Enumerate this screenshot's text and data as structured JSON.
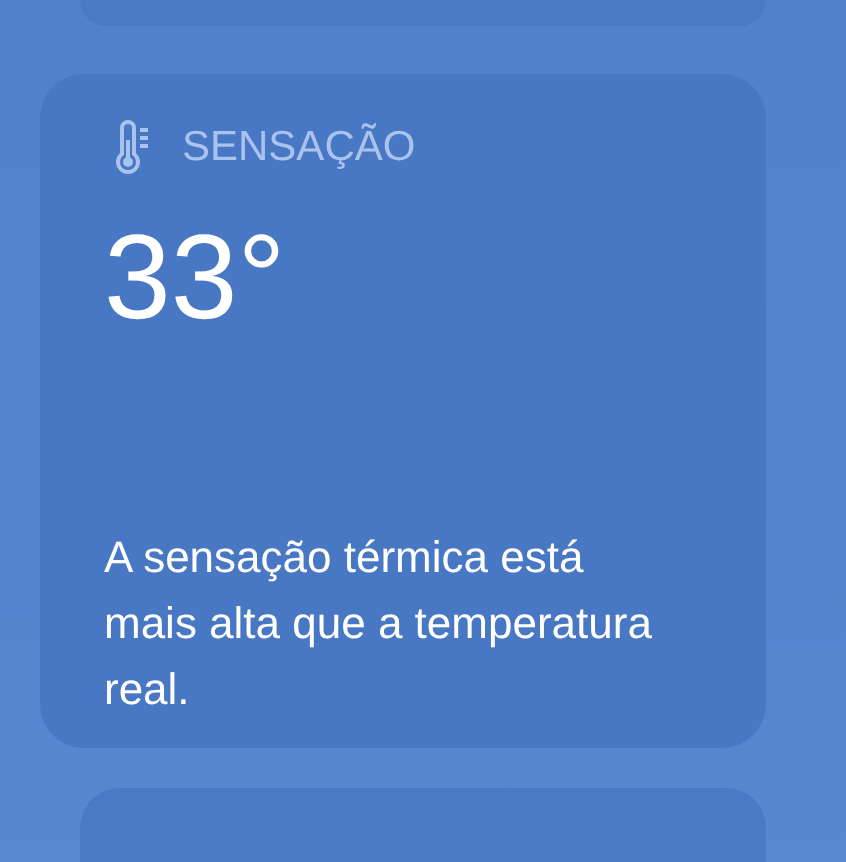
{
  "card": {
    "title": "SENSAÇÃO",
    "value": "33°",
    "description": "A sensação térmica está mais alta que a temperatura real."
  }
}
